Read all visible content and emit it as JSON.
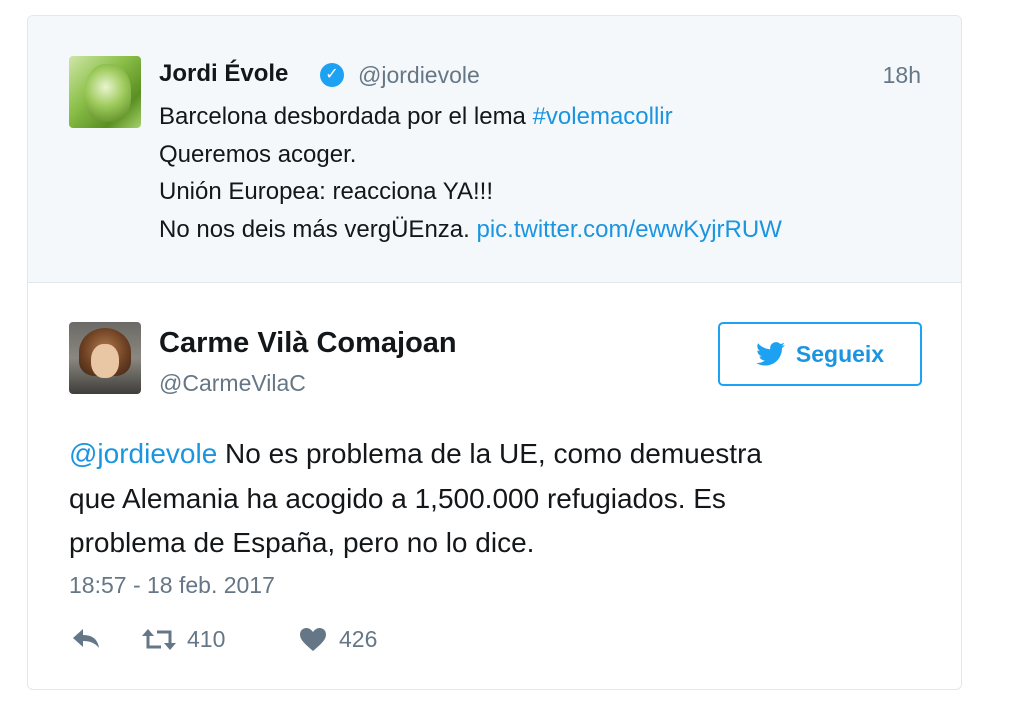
{
  "quoted_tweet": {
    "author_name": "Jordi Évole",
    "handle": "@jordievole",
    "time": "18h",
    "lines": {
      "line1_text": "Barcelona desbordada por el lema ",
      "line1_hashtag": "#volemacollir",
      "line2": "Queremos acoger.",
      "line3": "Unión Europea: reacciona YA!!!",
      "line4_text": "No nos deis más vergÜEnza. ",
      "line4_link": "pic.twitter.com/ewwKyjrRUW"
    }
  },
  "main_tweet": {
    "author_name": "Carme Vilà Comajoan",
    "handle": "@CarmeVilaC",
    "follow_label": "Segueix",
    "mention": "@jordievole",
    "line1": " No es problema de la UE, como demuestra",
    "line2": "que Alemania ha acogido a 1,500.000 refugiados. Es",
    "line3": "problema de España, pero no lo dice.",
    "timestamp": "18:57 - 18 feb. 2017",
    "retweets": "410",
    "likes": "426"
  },
  "icons": {
    "verified": "verified-badge-icon",
    "follow": "twitter-bird-icon",
    "reply": "reply-icon",
    "retweet": "retweet-icon",
    "like": "heart-icon"
  },
  "colors": {
    "link": "#1b95e0",
    "accent": "#1da1f2",
    "muted": "#657786",
    "quoted_bg": "#f5f8fa"
  }
}
